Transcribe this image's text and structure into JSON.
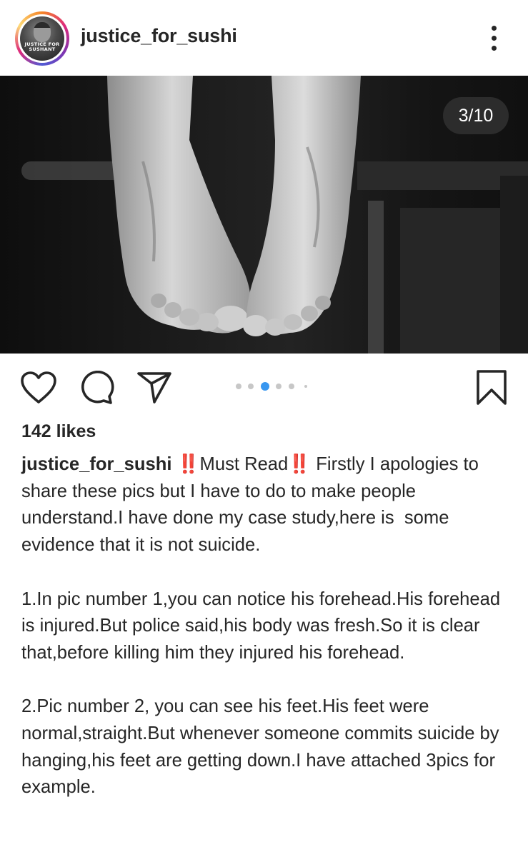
{
  "header": {
    "username": "justice_for_sushi",
    "avatar_text": "JUSTICE FOR SUSHANT",
    "more_icon": "more-vertical-icon"
  },
  "media": {
    "counter": "3/10",
    "description_icon": "photo"
  },
  "actions": {
    "like_icon": "heart-icon",
    "comment_icon": "comment-icon",
    "share_icon": "share-icon",
    "save_icon": "bookmark-icon",
    "carousel": {
      "total_dots_visible": 6,
      "active_index": 2
    },
    "accent_color": "#3897f0"
  },
  "post": {
    "likes": "142 likes",
    "caption_user": "justice_for_sushi",
    "caption_emoji_1": "‼️",
    "caption_part_1": "Must Read",
    "caption_emoji_2": "‼️",
    "caption_part_2": " Firstly I apologies to share these pics but I have to do to make people understand.I have done my case study,here is  some evidence that it is not suicide.\n\n1.In pic number 1,you can notice his forehead.His forehead is injured.But police said,his body was fresh.So it is clear that,before killing him they injured his forehead.\n\n2.Pic number 2, you can see his feet.His feet were normal,straight.But whenever someone commits suicide by hanging,his feet are getting down.I have attached 3pics for example."
  }
}
